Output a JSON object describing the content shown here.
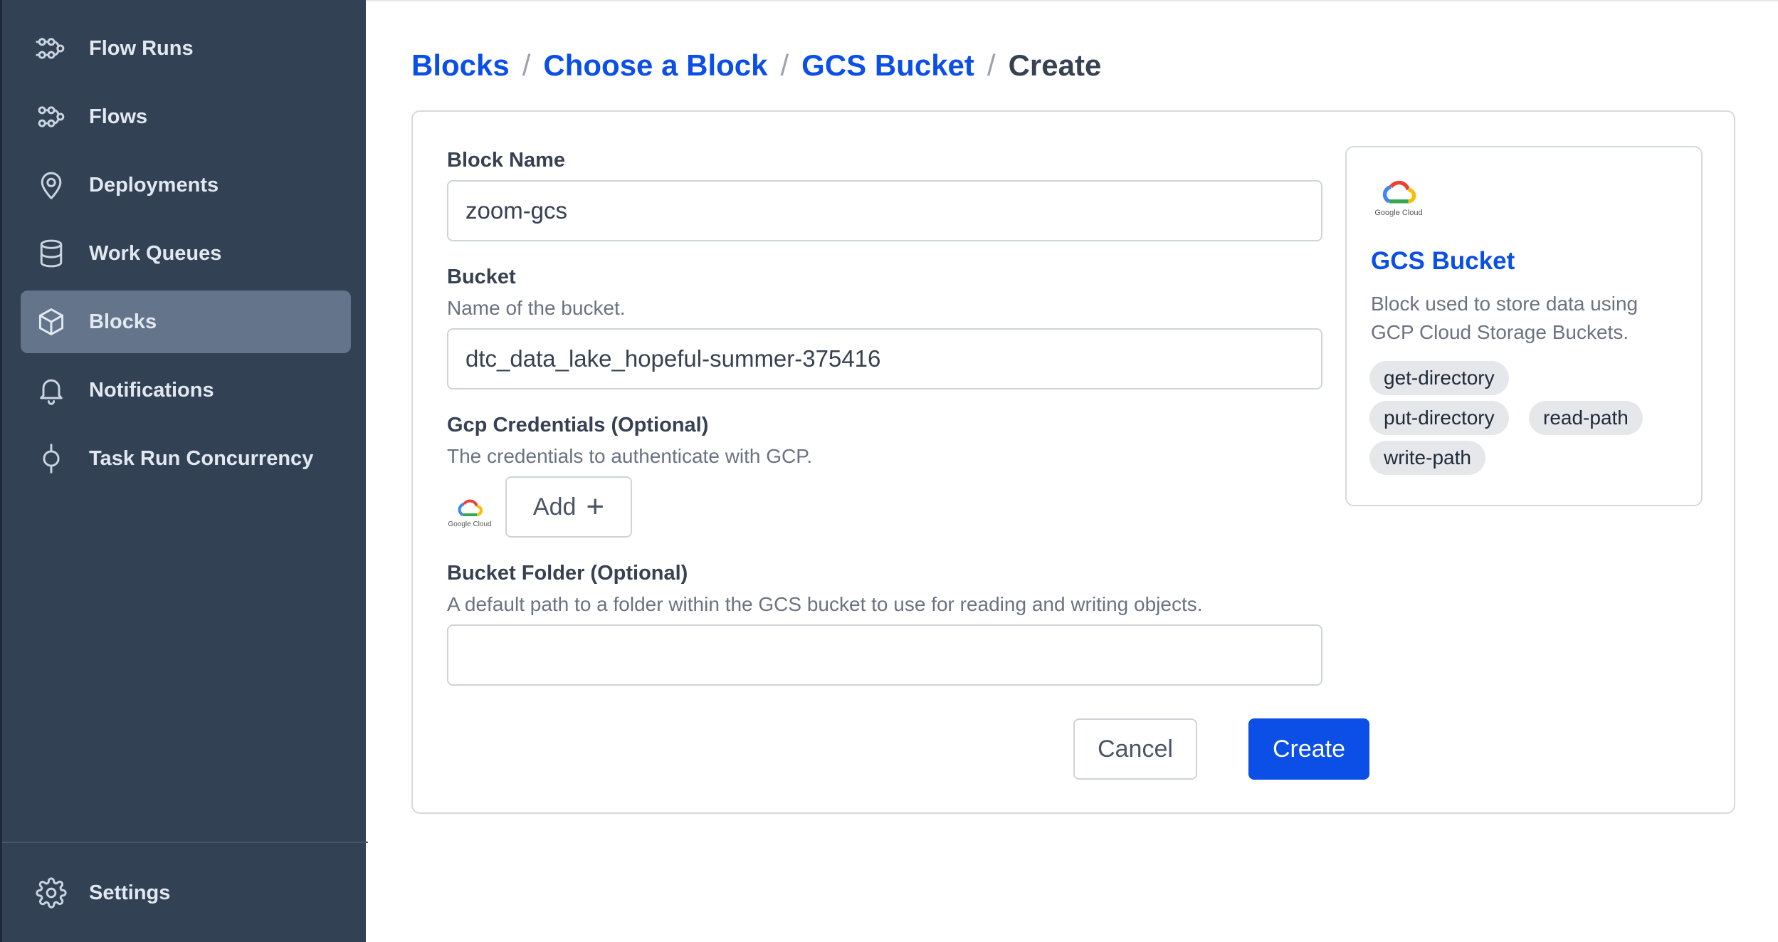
{
  "sidebar": {
    "items": [
      {
        "label": "Flow Runs",
        "icon": "flow-runs-icon"
      },
      {
        "label": "Flows",
        "icon": "flows-icon"
      },
      {
        "label": "Deployments",
        "icon": "map-pin-icon"
      },
      {
        "label": "Work Queues",
        "icon": "database-icon"
      },
      {
        "label": "Blocks",
        "icon": "cube-icon",
        "active": true
      },
      {
        "label": "Notifications",
        "icon": "bell-icon"
      },
      {
        "label": "Task Run Concurrency",
        "icon": "concurrency-icon"
      }
    ],
    "settings_label": "Settings"
  },
  "breadcrumb": {
    "items": [
      "Blocks",
      "Choose a Block",
      "GCS Bucket"
    ],
    "separator": "/",
    "current": "Create"
  },
  "form": {
    "block_name": {
      "label": "Block Name",
      "value": "zoom-gcs"
    },
    "bucket": {
      "label": "Bucket",
      "description": "Name of the bucket.",
      "value": "dtc_data_lake_hopeful-summer-375416"
    },
    "gcp_credentials": {
      "label": "Gcp Credentials (Optional)",
      "description": "The credentials to authenticate with GCP.",
      "add_label": "Add",
      "logo_text": "Google Cloud"
    },
    "bucket_folder": {
      "label": "Bucket Folder (Optional)",
      "description": "A default path to a folder within the GCS bucket to use for reading and writing objects.",
      "value": ""
    },
    "cancel_label": "Cancel",
    "create_label": "Create"
  },
  "info": {
    "logo_text": "Google Cloud",
    "title": "GCS Bucket",
    "description": "Block used to store data using GCP Cloud Storage Buckets.",
    "tags": [
      "get-directory",
      "put-directory",
      "read-path",
      "write-path"
    ]
  },
  "colors": {
    "sidebar_bg": "#334155",
    "active_item_bg": "#64748b",
    "accent": "#0b4fe6"
  }
}
